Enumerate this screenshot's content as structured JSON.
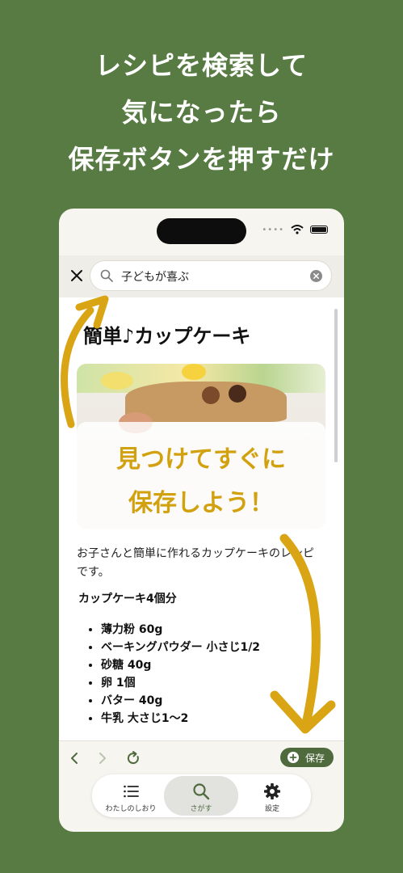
{
  "headline": [
    "レシピを検索して",
    "気になったら",
    "保存ボタンを押すだけ"
  ],
  "search": {
    "query": "子どもが喜ぶ"
  },
  "recipe": {
    "title": "簡単♪カップケーキ",
    "overlay": [
      "見つけてすぐに",
      "保存しよう！"
    ],
    "description": "お子さんと簡単に作れるカップケーキのレシピです。",
    "yield": "カップケーキ4個分",
    "ingredients": [
      "薄力粉 60g",
      "ベーキングパウダー 小さじ1/2",
      "砂糖 40g",
      "卵 1個",
      "バター 40g",
      "牛乳 大さじ1〜2"
    ]
  },
  "toolbar": {
    "save_label": "保存"
  },
  "tabs": [
    {
      "label": "わたしのしおり",
      "icon": "list-icon"
    },
    {
      "label": "さがす",
      "icon": "search-icon",
      "active": true
    },
    {
      "label": "設定",
      "icon": "gear-icon"
    }
  ],
  "colors": {
    "background": "#587b44",
    "accent": "#4f6b3e",
    "highlight": "#d2a10f",
    "arrow": "#d9a514"
  }
}
